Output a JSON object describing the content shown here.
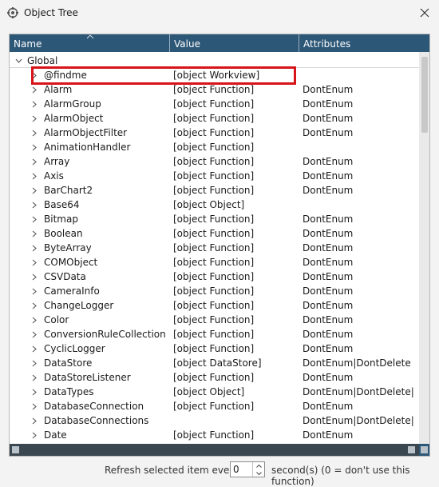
{
  "window": {
    "title": "Object Tree",
    "icon": "gear-icon",
    "close_icon": "close-icon"
  },
  "columns": {
    "name": "Name",
    "value": "Value",
    "attributes": "Attributes"
  },
  "root": {
    "name": "Global",
    "expanded": true
  },
  "rows": [
    {
      "name": "@findme",
      "value": "[object Workview]",
      "attributes": ""
    },
    {
      "name": "Alarm",
      "value": "[object Function]",
      "attributes": "DontEnum"
    },
    {
      "name": "AlarmGroup",
      "value": "[object Function]",
      "attributes": "DontEnum"
    },
    {
      "name": "AlarmObject",
      "value": "[object Function]",
      "attributes": "DontEnum"
    },
    {
      "name": "AlarmObjectFilter",
      "value": "[object Function]",
      "attributes": "DontEnum"
    },
    {
      "name": "AnimationHandler",
      "value": "[object Function]",
      "attributes": ""
    },
    {
      "name": "Array",
      "value": "[object Function]",
      "attributes": "DontEnum"
    },
    {
      "name": "Axis",
      "value": "[object Function]",
      "attributes": "DontEnum"
    },
    {
      "name": "BarChart2",
      "value": "[object Function]",
      "attributes": "DontEnum"
    },
    {
      "name": "Base64",
      "value": "[object Object]",
      "attributes": ""
    },
    {
      "name": "Bitmap",
      "value": "[object Function]",
      "attributes": "DontEnum"
    },
    {
      "name": "Boolean",
      "value": "[object Function]",
      "attributes": "DontEnum"
    },
    {
      "name": "ByteArray",
      "value": "[object Function]",
      "attributes": "DontEnum"
    },
    {
      "name": "COMObject",
      "value": "[object Function]",
      "attributes": "DontEnum"
    },
    {
      "name": "CSVData",
      "value": "[object Function]",
      "attributes": "DontEnum"
    },
    {
      "name": "CameraInfo",
      "value": "[object Function]",
      "attributes": "DontEnum"
    },
    {
      "name": "ChangeLogger",
      "value": "[object Function]",
      "attributes": "DontEnum"
    },
    {
      "name": "Color",
      "value": "[object Function]",
      "attributes": "DontEnum"
    },
    {
      "name": "ConversionRuleCollection",
      "value": "[object Function]",
      "attributes": "DontEnum"
    },
    {
      "name": "CyclicLogger",
      "value": "[object Function]",
      "attributes": "DontEnum"
    },
    {
      "name": "DataStore",
      "value": "[object DataStore]",
      "attributes": "DontEnum|DontDelete"
    },
    {
      "name": "DataStoreListener",
      "value": "[object Function]",
      "attributes": "DontEnum"
    },
    {
      "name": "DataTypes",
      "value": "[object Object]",
      "attributes": "DontEnum|DontDelete|R..."
    },
    {
      "name": "DatabaseConnection",
      "value": "[object Function]",
      "attributes": "DontEnum"
    },
    {
      "name": "DatabaseConnections",
      "value": "",
      "attributes": "DontEnum|DontDelete|R..."
    },
    {
      "name": "Date",
      "value": "[object Function]",
      "attributes": "DontEnum"
    }
  ],
  "highlighted_row": "@findme",
  "footer": {
    "label": "Refresh selected item every:",
    "interval_value": "0",
    "suffix": "second(s) (0 = don't use this function)"
  },
  "colors": {
    "header_bg": "#2c5777",
    "highlight_border": "#d7141a",
    "scroll_bg": "#3b4750"
  }
}
